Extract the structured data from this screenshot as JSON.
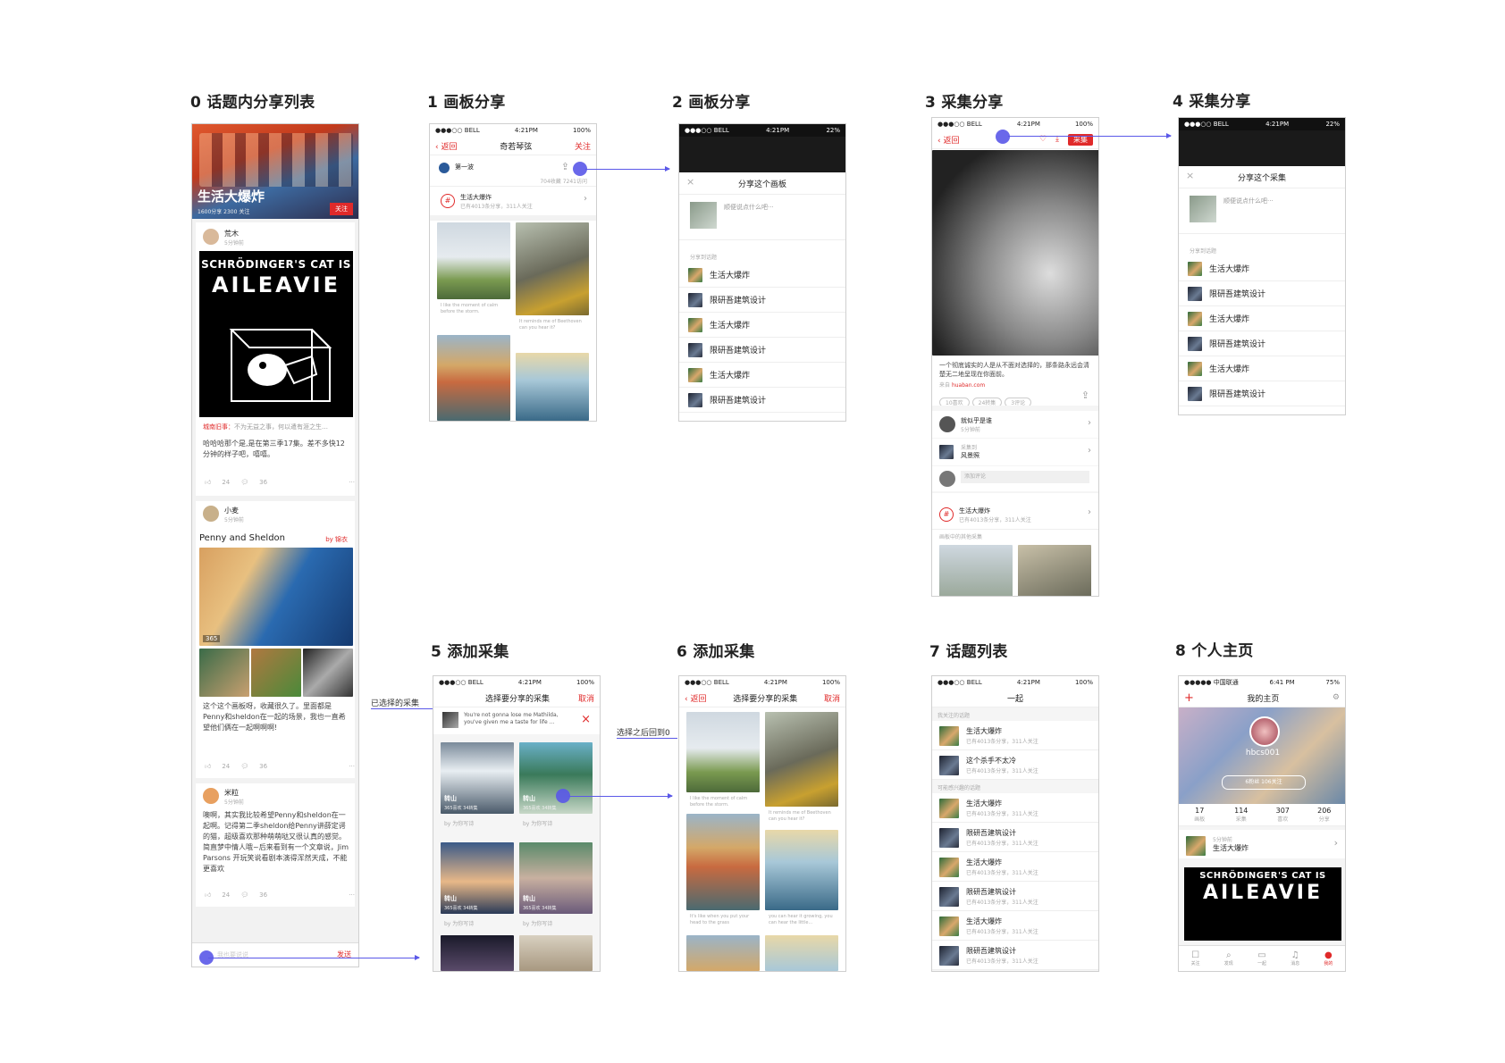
{
  "labels": [
    "0 话题内分享列表",
    "1 画板分享",
    "2 画板分享",
    "3 采集分享",
    "4 采集分享",
    "5 添加采集",
    "6 添加采集",
    "7 话题列表",
    "8 个人主页"
  ],
  "status": {
    "carrier": "●●●○○ BELL",
    "time": "4:21PM",
    "battery": "100%",
    "battery22": "22%",
    "carrier8": "●●●●● 中国联通",
    "time8": "6:41 PM",
    "battery8": "75%"
  },
  "screen0": {
    "hero_title": "生活大爆炸",
    "hero_sub": "1600分享 2300 关注",
    "follow": "关注",
    "post1": {
      "user": "荒木",
      "time": "5分钟前",
      "quote_tag": "城南旧事：",
      "quote": "不为无益之事，何以遣有涯之生…",
      "body": "哈哈哈那个是,是在第三季17集。差不多快12分钟的样子吧，嘻嘻。",
      "likes": "24",
      "comments": "36"
    },
    "schro_line1": "SCHRÖDINGER'S CAT IS",
    "schro_line2": "AILEAVIE",
    "post2": {
      "user": "小麦",
      "time": "5分钟前",
      "title": "Penny and Sheldon",
      "by": "by 锦衣",
      "count": "365",
      "body": "这个这个画板呀，收藏很久了。里面都是Penny和sheldon在一起的场景，我也一直希望他们俩在一起啊啊啊!",
      "likes": "24",
      "comments": "36"
    },
    "post3": {
      "user": "米粒",
      "time": "5分钟前",
      "body": "噢啊，其实我比较希望Penny和sheldon在一起啊。记得第二季sheldon给Penny讲薛定谔的猫，超级喜欢那种萌萌哒又很认真的感觉。简直梦中情人哦~后来看到有一个文章说，Jim Parsons 开玩笑说看剧本演得浑然天成，不能更喜欢",
      "likes": "24",
      "comments": "36"
    },
    "input_placeholder": "我也要说说",
    "send": "发送"
  },
  "screen1": {
    "back": "返回",
    "title": "奇若琴弦",
    "follow": "关注",
    "board": "第一波",
    "meta1": "704收藏",
    "meta2": "7241访问",
    "topic": "生活大爆炸",
    "topic_sub": "已有4013条分享，311人关注",
    "cap1": "I like the moment of calm before the storm.",
    "cap2": "It reminds me of Beethoven can you hear it?"
  },
  "screen2": {
    "title": "分享这个画板",
    "placeholder": "顺便说点什么吧···",
    "section": "分享到话题",
    "items": [
      "生活大爆炸",
      "限研吾建筑设计",
      "生活大爆炸",
      "限研吾建筑设计",
      "生活大爆炸",
      "限研吾建筑设计"
    ]
  },
  "screen3": {
    "back": "返回",
    "collect": "采集",
    "desc": "一个彻底诚实的人是从不面对选择的，那条路永远会清楚无二地呈现在你面前。",
    "source_label": "来自",
    "source": "huaban.com",
    "pills": [
      "10喜欢",
      "24转集",
      "3评论"
    ],
    "by_user": "就似乎是谁",
    "by_time": "5分钟前",
    "collected_label": "采集到",
    "collected_board": "风景照",
    "comment_ph": "添加评论",
    "topic": "生活大爆炸",
    "topic_sub": "已有4013条分享，311人关注",
    "more_label": "画板中的其他采集"
  },
  "screen4": {
    "title": "分享这个采集",
    "placeholder": "顺便说点什么吧···",
    "section": "分享到话题",
    "items": [
      "生活大爆炸",
      "限研吾建筑设计",
      "生活大爆炸",
      "限研吾建筑设计",
      "生活大爆炸",
      "限研吾建筑设计"
    ]
  },
  "screen5": {
    "title": "选择要分享的采集",
    "cancel": "取消",
    "selected_text": "You're not gonna lose me Mathilda, you've given me a taste for life ...",
    "tag": "转山",
    "tag_sub": "365喜欢 34转集",
    "by": "by 为你写诗",
    "note": "已选择的采集"
  },
  "screen6": {
    "back": "返回",
    "title": "选择要分享的采集",
    "cancel": "取消",
    "note": "选择之后回到0",
    "cap1": "I like the moment of calm before the storm.",
    "cap2": "It reminds me of Beethoven can you hear it?",
    "cap3": "It's like when you put your head to the grass",
    "cap4": "you can hear it growing, you can hear the little..."
  },
  "screen7": {
    "title": "一起",
    "section1": "我关注的话题",
    "section2": "可能感兴趣的话题",
    "items1": [
      "生活大爆炸",
      "这个杀手不太冷"
    ],
    "items2": [
      "生活大爆炸",
      "限研吾建筑设计",
      "生活大爆炸",
      "限研吾建筑设计",
      "生活大爆炸",
      "限研吾建筑设计"
    ],
    "sub": "已有4013条分享，311人关注"
  },
  "screen8": {
    "title": "我的主页",
    "username": "hbcs001",
    "follow_pill": "6粉丝 106关注",
    "stats": [
      {
        "n": "17",
        "l": "画板"
      },
      {
        "n": "114",
        "l": "采集"
      },
      {
        "n": "307",
        "l": "喜欢"
      },
      {
        "n": "206",
        "l": "分享"
      }
    ],
    "feed_time": "5分钟前",
    "feed_topic": "生活大爆炸",
    "tabs": [
      "关注",
      "发现",
      "一起",
      "消息",
      "我的"
    ]
  }
}
